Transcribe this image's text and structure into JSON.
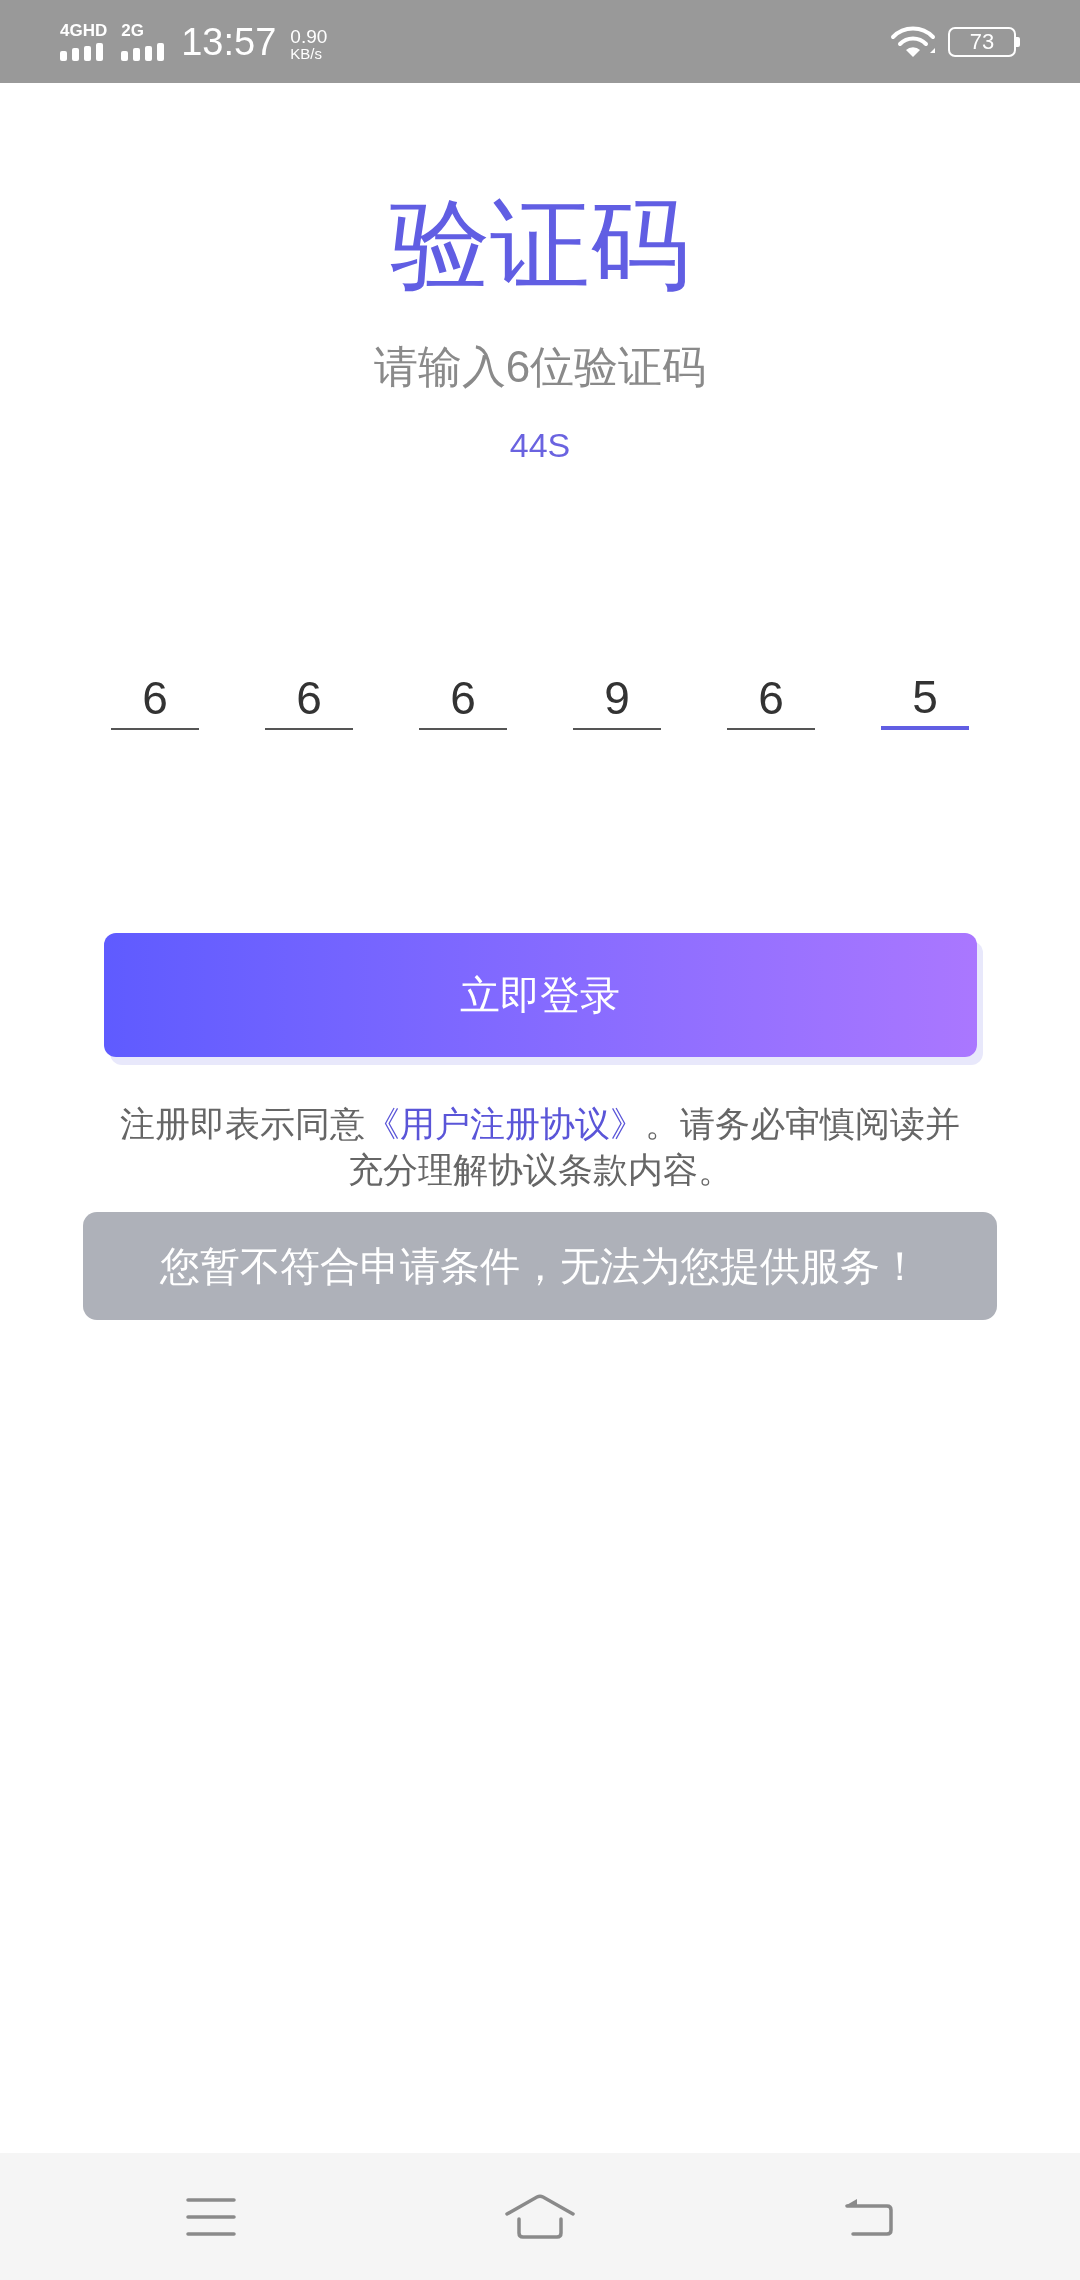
{
  "status_bar": {
    "network_1": "4GHD",
    "network_2": "2G",
    "time": "13:57",
    "speed": "0.90",
    "speed_unit": "KB/s",
    "battery": "73"
  },
  "title": "验证码",
  "subtitle": "请输入6位验证码",
  "countdown": "44S",
  "code_digits": [
    {
      "value": "6",
      "active": false
    },
    {
      "value": "6",
      "active": false
    },
    {
      "value": "6",
      "active": false
    },
    {
      "value": "9",
      "active": false
    },
    {
      "value": "6",
      "active": false
    },
    {
      "value": "5",
      "active": true
    }
  ],
  "login_button": "立即登录",
  "agreement": {
    "prefix": "注册即表示同意",
    "link": "《用户注册协议》",
    "suffix": "。请务必审慎阅读并充分理解协议条款内容。"
  },
  "toast": "您暂不符合申请条件，无法为您提供服务！"
}
